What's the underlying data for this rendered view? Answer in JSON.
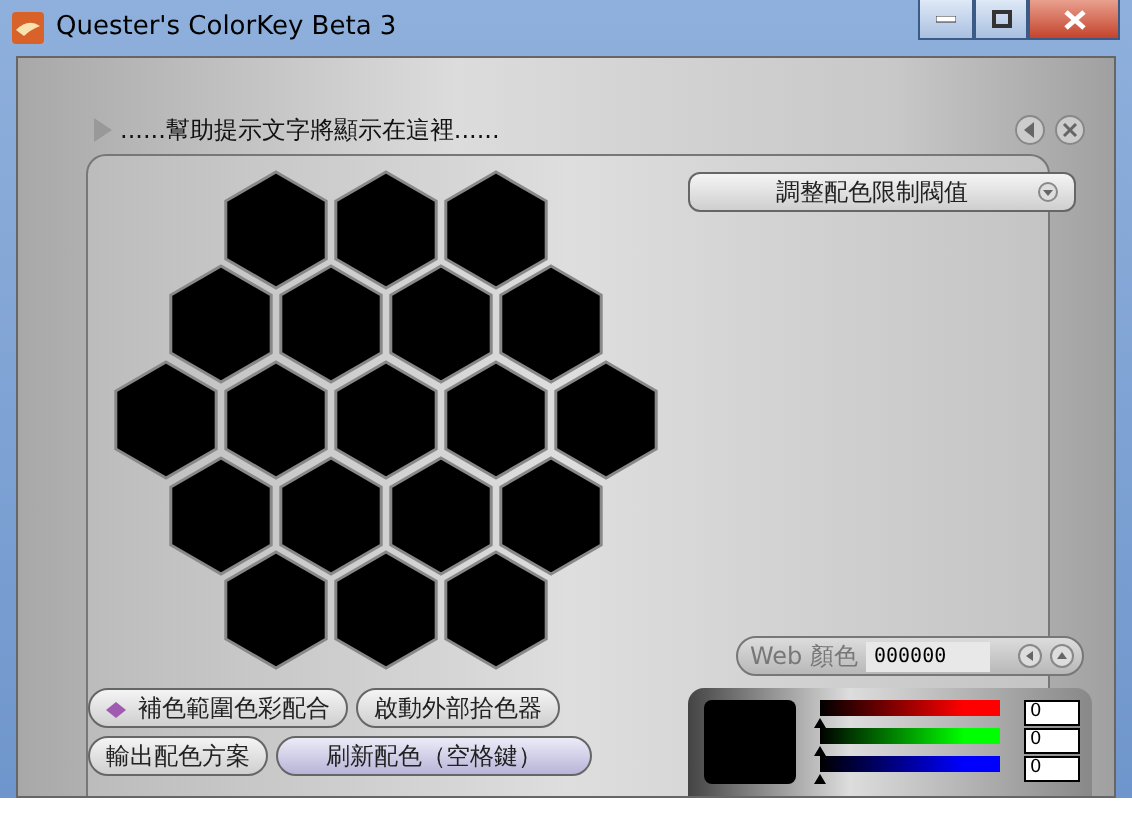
{
  "window": {
    "title": "Quester's ColorKey Beta 3"
  },
  "help_text": "......幫助提示文字將顯示在這裡......",
  "threshold_button": "調整配色限制閥值",
  "swatch_rows": [
    [
      {
        "color": "#000000"
      },
      {
        "color": "#000000"
      },
      {
        "color": "#000000"
      }
    ],
    [
      {
        "color": "#000000"
      },
      {
        "color": "#000000"
      },
      {
        "color": "#000000"
      },
      {
        "color": "#000000"
      }
    ],
    [
      {
        "color": "#000000"
      },
      {
        "color": "#000000"
      },
      {
        "color": "#000000"
      },
      {
        "color": "#000000"
      },
      {
        "color": "#000000"
      }
    ],
    [
      {
        "color": "#000000"
      },
      {
        "color": "#000000"
      },
      {
        "color": "#000000"
      },
      {
        "color": "#000000"
      }
    ],
    [
      {
        "color": "#000000"
      },
      {
        "color": "#000000"
      },
      {
        "color": "#000000"
      }
    ]
  ],
  "web_color": {
    "label": "Web 顏色",
    "value": "000000"
  },
  "preview": {
    "color": "#000000"
  },
  "channels": [
    {
      "color": "#ff0000",
      "level": 0,
      "value": "0"
    },
    {
      "color": "#00ff00",
      "level": 0,
      "value": "0"
    },
    {
      "color": "#0000ff",
      "level": 0,
      "value": "0"
    }
  ],
  "buttons": [
    {
      "label": "補色範圍色彩配合",
      "kind": "icon"
    },
    {
      "label": "啟動外部拾色器",
      "kind": "plain"
    },
    {
      "label": "輸出配色方案",
      "kind": "plain"
    },
    {
      "label": "刷新配色（空格鍵）",
      "kind": "accent"
    }
  ]
}
